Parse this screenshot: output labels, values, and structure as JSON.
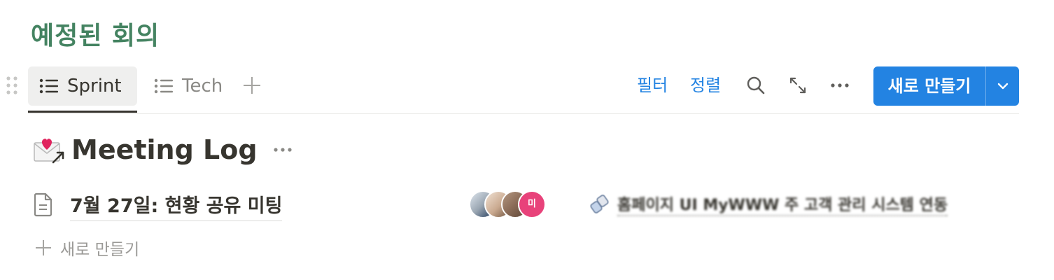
{
  "database": {
    "title": "예정된 회의"
  },
  "tabs": [
    {
      "label": "Sprint",
      "icon": "list-icon",
      "active": true
    },
    {
      "label": "Tech",
      "icon": "list-icon",
      "active": false
    }
  ],
  "toolbar": {
    "filter_label": "필터",
    "sort_label": "정렬",
    "icons": [
      "search-icon",
      "expand-icon",
      "more-icon"
    ],
    "new_button_label": "새로 만들기",
    "accent_color": "#2383e2"
  },
  "group": {
    "emoji": "love-letter-icon",
    "title": "Meeting Log"
  },
  "rows": [
    {
      "title": "7월 27일: 현황 공유 미팅",
      "icon": "page-icon",
      "attendees_count": 4,
      "avatar_initial": "미",
      "related_page": "홈페이지 UI MyWWW 주 고객 관리 시스템 연동"
    }
  ],
  "add_row_label": "새로 만들기",
  "colors": {
    "heading": "#448361",
    "text": "#37352f",
    "muted": "#9b9a97"
  }
}
